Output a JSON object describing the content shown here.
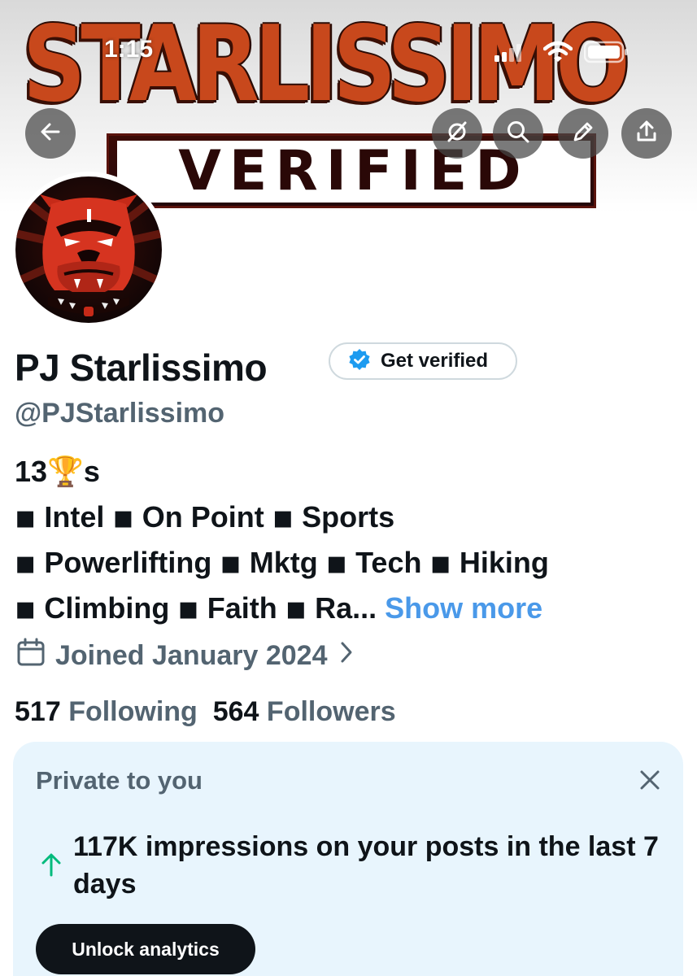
{
  "status_bar": {
    "time": "1:15",
    "icons": [
      "cellular-signal-icon",
      "wifi-icon",
      "battery-icon"
    ]
  },
  "banner": {
    "title": "STARLISSIMO",
    "subtitle": "VERIFIED",
    "colors": {
      "title": "#c8481c",
      "dark": "#2a0807"
    }
  },
  "nav": {
    "buttons": [
      "back-arrow-icon",
      "grok-icon",
      "search-icon",
      "edit-pencil-icon",
      "share-icon"
    ]
  },
  "profile": {
    "display_name": "PJ Starlissimo",
    "get_verified_label": "Get verified",
    "handle": "@PJStarlissimo",
    "bio_lines": [
      "13🏆s",
      "◾ Intel  ◾ On Point  ◾ Sports",
      "◾ Powerlifting  ◾ Mktg ◾ Tech  ◾ Hiking",
      "◾ Climbing  ◾ Faith  ◾ Ra... "
    ],
    "show_more": "Show more",
    "joined": "Joined January 2024",
    "following_count": "517",
    "following_label": "Following",
    "followers_count": "564",
    "followers_label": "Followers"
  },
  "private_card": {
    "title": "Private to you",
    "headline": "117K impressions on your posts in the last 7 days",
    "button_label": "Unlock analytics",
    "colors": {
      "background": "#e8f5fd",
      "arrow": "#00ba7c"
    }
  },
  "colors": {
    "accent_blue": "#4a99e9",
    "text_primary": "#0f1419",
    "text_secondary": "#536471"
  }
}
